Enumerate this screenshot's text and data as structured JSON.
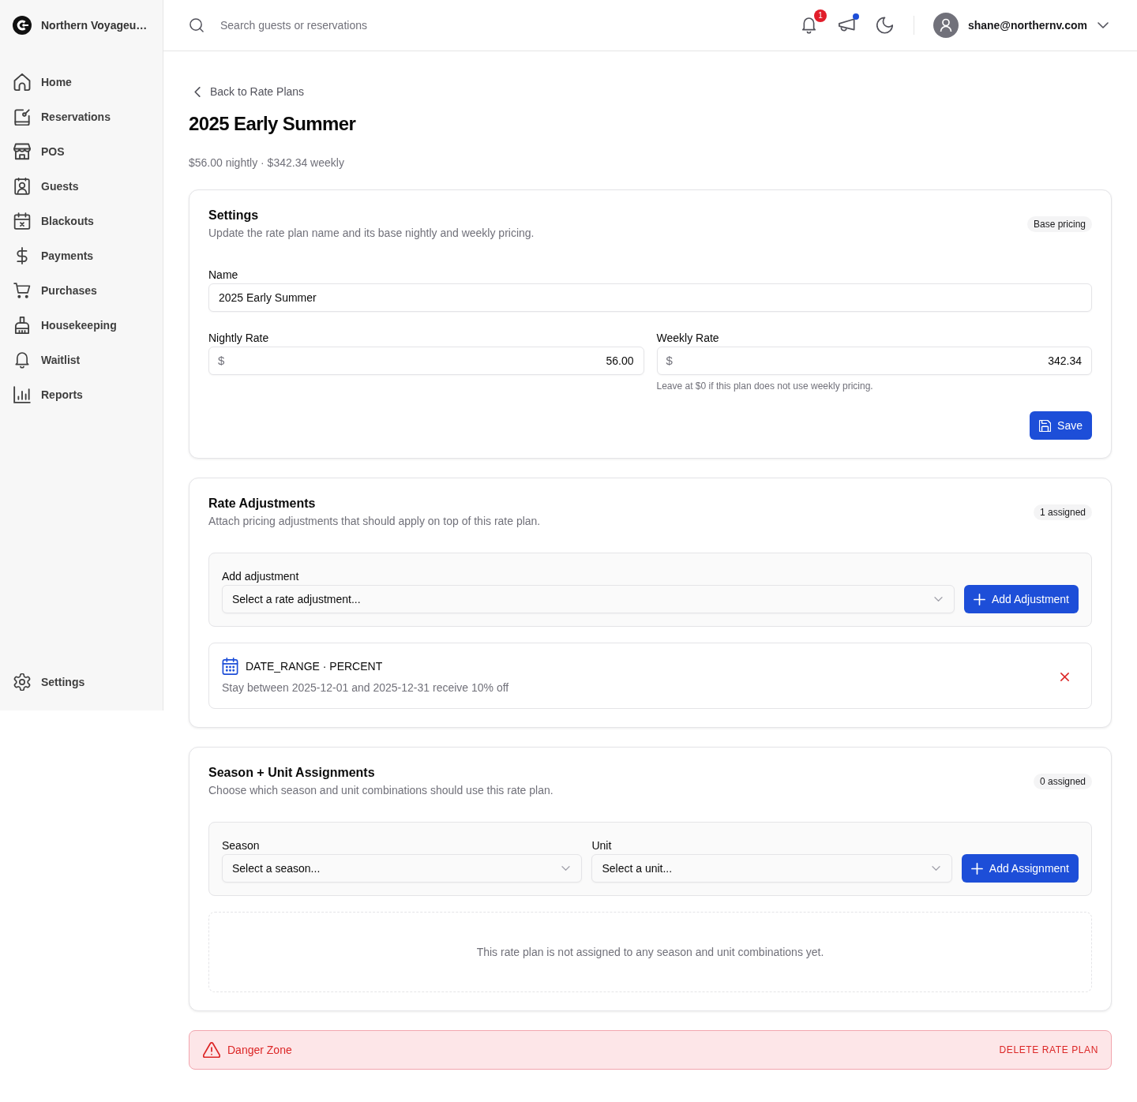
{
  "sidebar": {
    "brand": "Northern Voyageu…",
    "items": [
      {
        "label": "Home",
        "selected": false
      },
      {
        "label": "Reservations",
        "selected": false
      },
      {
        "label": "POS",
        "selected": false
      },
      {
        "label": "Guests",
        "selected": false
      },
      {
        "label": "Blackouts",
        "selected": false
      },
      {
        "label": "Payments",
        "selected": false
      },
      {
        "label": "Purchases",
        "selected": false
      },
      {
        "label": "Housekeeping",
        "selected": false
      },
      {
        "label": "Waitlist",
        "selected": false
      },
      {
        "label": "Reports",
        "selected": false
      }
    ],
    "footer_items": [
      {
        "label": "Settings",
        "selected": false
      }
    ]
  },
  "header": {
    "search": {
      "placeholder": "Search guests or reservations"
    },
    "notifications": {
      "badge": "1"
    },
    "announcements": {
      "unread": true
    },
    "account": {
      "email": "shane@northernv.com"
    }
  },
  "page": {
    "back_link": "Back to Rate Plans",
    "title": "2025 Early Summer",
    "summary": "$56.00 nightly · $342.34 weekly"
  },
  "settings": {
    "title": "Settings",
    "description": "Update the rate plan name and its base nightly and weekly pricing.",
    "badge": "Base pricing",
    "name_field": {
      "label": "Name",
      "value": "2025 Early Summer"
    },
    "nightly_rate": {
      "label": "Nightly Rate",
      "prefix": "$",
      "value": "56.00"
    },
    "weekly_rate": {
      "label": "Weekly Rate",
      "prefix": "$",
      "value": "342.34",
      "help_text": "Leave at $0 if this plan does not use weekly pricing."
    },
    "save_button": "Save"
  },
  "rate_adjustments": {
    "title": "Rate Adjustments",
    "description": "Attach pricing adjustments that should apply on top of this rate plan.",
    "badge": "1 assigned",
    "add_form": {
      "label": "Add adjustment",
      "select": {
        "placeholder": "Select a rate adjustment..."
      },
      "button": "Add Adjustment"
    },
    "items": [
      {
        "title": "DATE_RANGE · PERCENT",
        "description": "Stay between 2025-12-01 and 2025-12-31 receive 10% off"
      }
    ]
  },
  "assignments": {
    "title": "Season + Unit Assignments",
    "description": "Choose which season and unit combinations should use this rate plan.",
    "badge": "0 assigned",
    "add_form": {
      "season": {
        "label": "Season",
        "placeholder": "Select a season..."
      },
      "unit": {
        "label": "Unit",
        "placeholder": "Select a unit..."
      },
      "button": "Add Assignment"
    },
    "empty_message": "This rate plan is not assigned to any season and unit combinations yet."
  },
  "danger_zone": {
    "title": "Danger Zone",
    "action": "DELETE RATE PLAN"
  }
}
